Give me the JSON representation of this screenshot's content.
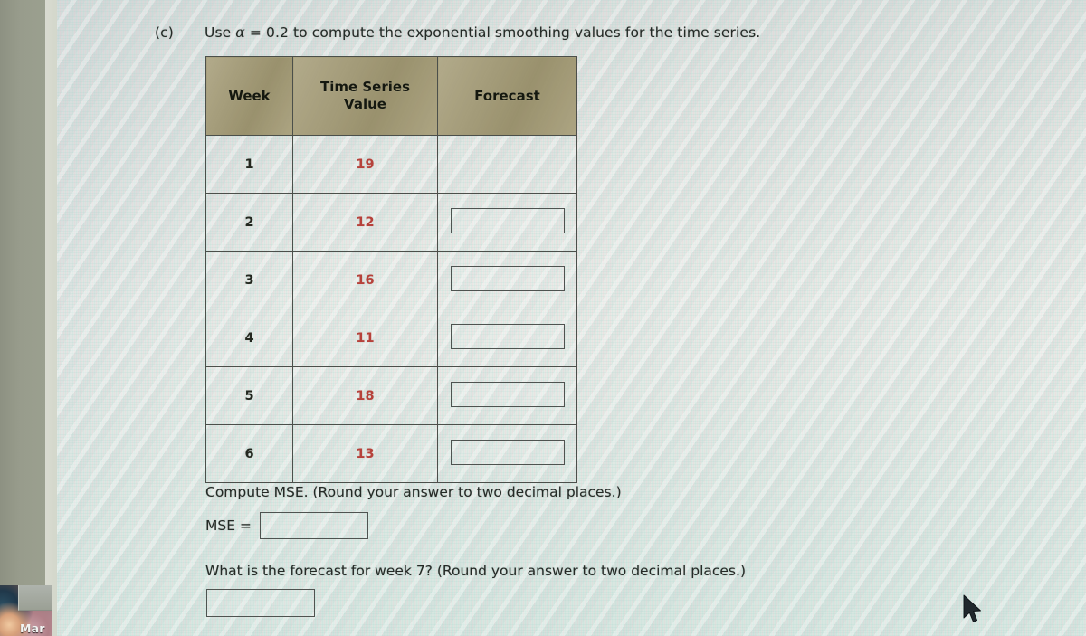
{
  "question": {
    "tag": "(c)",
    "prompt_before_alpha": "Use ",
    "alpha_symbol": "α",
    "prompt_after_alpha": " = 0.2 to compute the exponential smoothing values for the time series."
  },
  "table": {
    "headers": [
      "Week",
      "Time Series Value",
      "Forecast"
    ],
    "header_lines": {
      "week": "Week",
      "value_line1": "Time Series",
      "value_line2": "Value",
      "forecast": "Forecast"
    },
    "rows": [
      {
        "week": "1",
        "value": "19",
        "forecast": "",
        "has_input": false
      },
      {
        "week": "2",
        "value": "12",
        "forecast": "",
        "has_input": true
      },
      {
        "week": "3",
        "value": "16",
        "forecast": "",
        "has_input": true
      },
      {
        "week": "4",
        "value": "11",
        "forecast": "",
        "has_input": true
      },
      {
        "week": "5",
        "value": "18",
        "forecast": "",
        "has_input": true
      },
      {
        "week": "6",
        "value": "13",
        "forecast": "",
        "has_input": true
      }
    ]
  },
  "mse_section": {
    "instruction": "Compute MSE. (Round your answer to two decimal places.)",
    "label": "MSE =",
    "value": "",
    "placeholder": ""
  },
  "week7_section": {
    "instruction": "What is the forecast for week 7? (Round your answer to two decimal places.)",
    "value": "",
    "placeholder": ""
  },
  "taskbar": {
    "item_label": "Mar"
  },
  "colors": {
    "header_background": "#a39a74",
    "value_text": "#b6413a",
    "body_text": "#242a26",
    "border": "#4b4f4a",
    "page_background": "#e7ebe7",
    "bezel": "#989c8c"
  }
}
